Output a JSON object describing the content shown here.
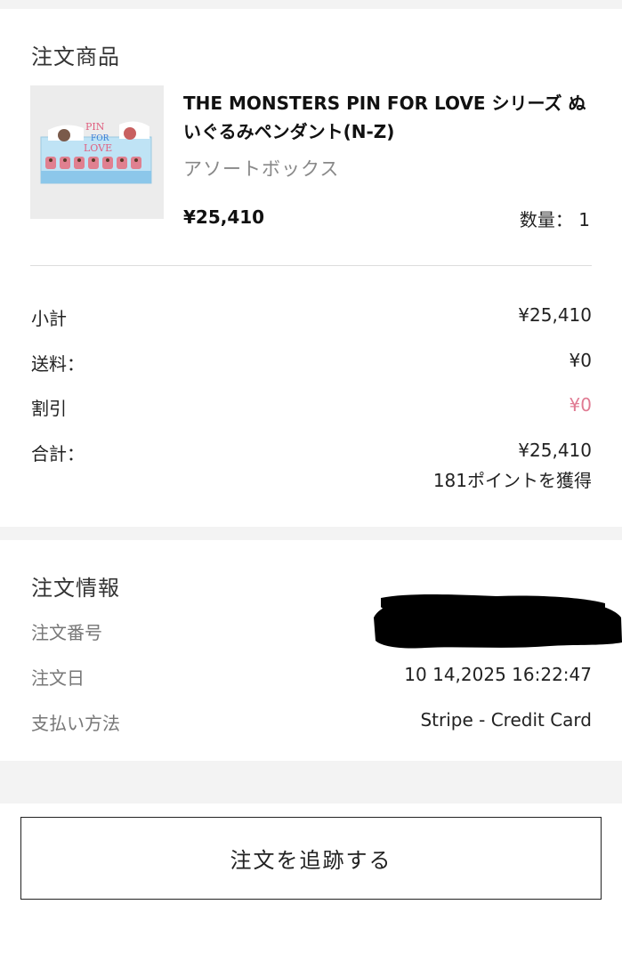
{
  "products_section": {
    "title": "注文商品",
    "item": {
      "name": "THE MONSTERS PIN FOR LOVE シリーズ ぬいぐるみペンダント(N-Z)",
      "variant": "アソートボックス",
      "price": "¥25,410",
      "quantity": "数量： 1",
      "image_icon": "product-box-image"
    }
  },
  "summary": {
    "subtotal_label": "小計",
    "subtotal_value": "¥25,410",
    "shipping_label": "送料：",
    "shipping_value": "¥0",
    "discount_label": "割引",
    "discount_value": "¥0",
    "total_label": "合計：",
    "total_value": "¥25,410",
    "points": "181ポイントを獲得"
  },
  "order_info": {
    "title": "注文情報",
    "order_number_label": "注文番号",
    "order_date_label": "注文日",
    "order_date_value": "10 14,2025 16:22:47",
    "payment_label": "支払い方法",
    "payment_value": "Stripe - Credit Card"
  },
  "actions": {
    "track_label": "注文を追跡する"
  },
  "colors": {
    "discount": "#e07b93",
    "page_bg": "#f3f3f3"
  }
}
